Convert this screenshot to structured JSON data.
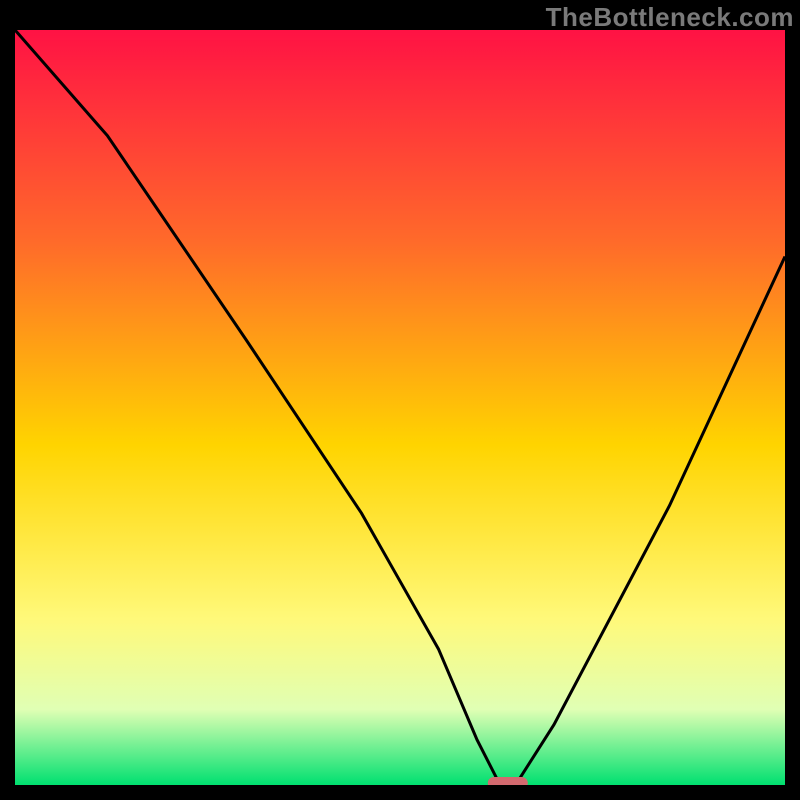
{
  "watermark": "TheBottleneck.com",
  "colors": {
    "frame": "#000000",
    "grad_top": "#ff1244",
    "grad_mid1": "#ff6a2a",
    "grad_mid2": "#ffd400",
    "grad_mid3": "#fff97a",
    "grad_mid4": "#e0ffb4",
    "grad_bottom": "#00e070",
    "curve": "#000000",
    "marker": "#d36a6f"
  },
  "chart_data": {
    "type": "line",
    "title": "",
    "xlabel": "",
    "ylabel": "",
    "xlim": [
      0,
      100
    ],
    "ylim": [
      0,
      100
    ],
    "series": [
      {
        "name": "bottleneck-curve",
        "x": [
          0,
          12,
          18,
          30,
          45,
          55,
          60,
          63,
          65,
          70,
          85,
          100
        ],
        "values": [
          100,
          86,
          77,
          59,
          36,
          18,
          6,
          0,
          0,
          8,
          37,
          70
        ]
      }
    ],
    "annotations": [
      {
        "name": "optimal-marker",
        "x": 64,
        "y": 0,
        "shape": "pill",
        "color": "#d36a6f"
      }
    ]
  }
}
